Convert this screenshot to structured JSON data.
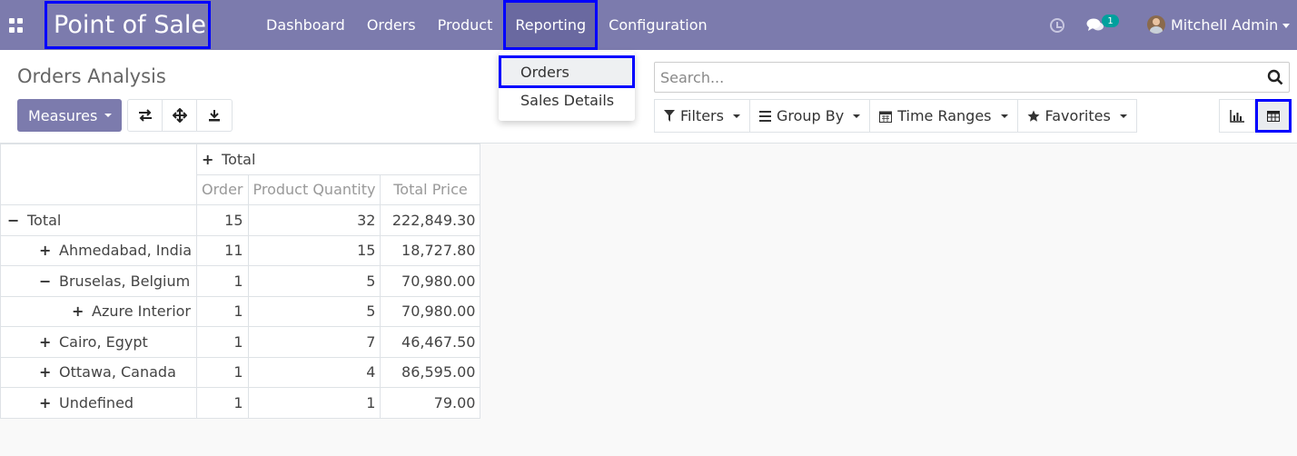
{
  "navbar": {
    "brand": "Point of Sale",
    "menu": [
      "Dashboard",
      "Orders",
      "Product",
      "Reporting",
      "Configuration"
    ],
    "chat_count": "1",
    "user": "Mitchell Admin"
  },
  "control_panel": {
    "breadcrumb": "Orders Analysis",
    "measures_label": "Measures",
    "search_placeholder": "Search...",
    "filters": [
      "Filters",
      "Group By",
      "Time Ranges",
      "Favorites"
    ]
  },
  "dropdown": {
    "items": [
      "Orders",
      "Sales Details"
    ]
  },
  "pivot": {
    "col_header": "Total",
    "measures": [
      "Order",
      "Product Quantity",
      "Total Price"
    ],
    "rows": [
      {
        "label": "Total",
        "sign": "−",
        "values": [
          "15",
          "32",
          "222,849.30"
        ]
      },
      {
        "label": "Ahmedabad, India",
        "sign": "+",
        "values": [
          "11",
          "15",
          "18,727.80"
        ]
      },
      {
        "label": "Bruselas, Belgium",
        "sign": "−",
        "values": [
          "1",
          "5",
          "70,980.00"
        ]
      },
      {
        "label": "Azure Interior",
        "sign": "+",
        "values": [
          "1",
          "5",
          "70,980.00"
        ]
      },
      {
        "label": "Cairo, Egypt",
        "sign": "+",
        "values": [
          "1",
          "7",
          "46,467.50"
        ]
      },
      {
        "label": "Ottawa, Canada",
        "sign": "+",
        "values": [
          "1",
          "4",
          "86,595.00"
        ]
      },
      {
        "label": "Undefined",
        "sign": "+",
        "values": [
          "1",
          "1",
          "79.00"
        ]
      }
    ]
  },
  "colors": {
    "navbar": "#7c7bad",
    "highlight": "#0000ff",
    "badge": "#00a09d"
  }
}
